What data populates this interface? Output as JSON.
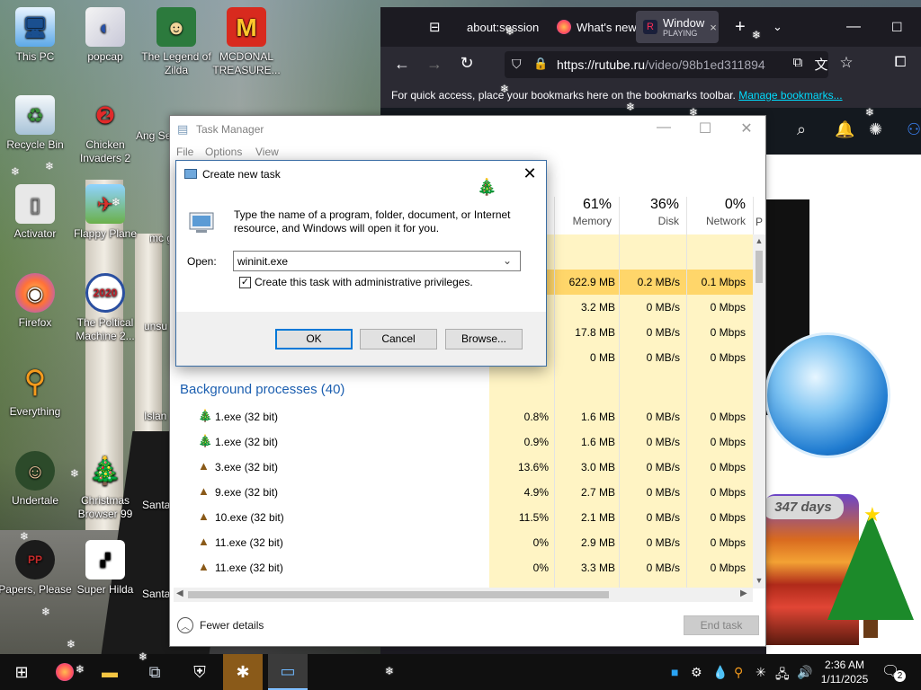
{
  "desktop": {
    "icons": [
      {
        "label": "This PC",
        "icon": "computer-icon"
      },
      {
        "label": "popcap",
        "icon": "popcap-icon"
      },
      {
        "label": "The Legend of Zilda",
        "icon": "legend-of-zilda-icon"
      },
      {
        "label": "MCDONAL TREASURE...",
        "icon": "mcdonalds-icon"
      },
      {
        "label": "Recycle Bin",
        "icon": "recycle-bin-icon"
      },
      {
        "label": "Chicken Invaders 2",
        "icon": "chicken-invaders-icon"
      },
      {
        "label": "Ang Se",
        "icon": "game-icon"
      },
      {
        "label": "Activator",
        "icon": "activator-icon"
      },
      {
        "label": "Flappy Plane",
        "icon": "flappy-plane-icon"
      },
      {
        "label": "mc ga",
        "icon": "game-icon"
      },
      {
        "label": "Firefox",
        "icon": "firefox-icon"
      },
      {
        "label": "The Poltical Machine 2...",
        "icon": "political-machine-icon"
      },
      {
        "label": "unsu",
        "icon": "game-icon"
      },
      {
        "label": "Everything",
        "icon": "everything-search-icon"
      },
      {
        "label": "Islan X",
        "icon": "game-icon"
      },
      {
        "label": "Undertale",
        "icon": "undertale-icon"
      },
      {
        "label": "Christmas Browser 99",
        "icon": "christmas-tree-icon"
      },
      {
        "label": "Santa Tro",
        "icon": "game-icon"
      },
      {
        "label": "Papers, Please",
        "icon": "papers-please-icon"
      },
      {
        "label": "Super Hilda",
        "icon": "super-hilda-icon"
      },
      {
        "label": "Santa Troub",
        "icon": "game-icon"
      }
    ]
  },
  "browser": {
    "tabs": [
      {
        "label": "about:session",
        "icon": "firefox-view-icon"
      },
      {
        "label": "What's new",
        "icon": "firefox-icon"
      },
      {
        "label": "Window",
        "sub": "PLAYING",
        "icon": "rutube-icon",
        "close": "×"
      }
    ],
    "new_tab": "+",
    "url_host": "https://rutube.ru",
    "url_path": "/video/98b1ed311894",
    "bookmarks_text": "For quick access, place your bookmarks here on the bookmarks toolbar.",
    "bookmarks_link": "Manage bookmarks..."
  },
  "snowglobe": {
    "days": "347 days"
  },
  "taskmgr": {
    "title": "Task Manager",
    "menu": [
      "File",
      "Options",
      "View"
    ],
    "columns": [
      {
        "pct": "61%",
        "label": "Memory"
      },
      {
        "pct": "36%",
        "label": "Disk"
      },
      {
        "pct": "0%",
        "label": "Network"
      }
    ],
    "col_cut": "P",
    "top_rows": [
      {
        "cpu": "",
        "memory": "622.9 MB",
        "disk": "0.2 MB/s",
        "network": "0.1 Mbps"
      },
      {
        "cpu": "",
        "memory": "3.2 MB",
        "disk": "0 MB/s",
        "network": "0 Mbps"
      },
      {
        "cpu": "",
        "memory": "17.8 MB",
        "disk": "0 MB/s",
        "network": "0 Mbps"
      },
      {
        "cpu": "",
        "memory": "0 MB",
        "disk": "0 MB/s",
        "network": "0 Mbps"
      }
    ],
    "section_title": "Background processes (40)",
    "bg_rows": [
      {
        "name": "1.exe (32 bit)",
        "icon": "tree-icon",
        "cpu": "0.8%",
        "memory": "1.6 MB",
        "disk": "0 MB/s",
        "network": "0 Mbps"
      },
      {
        "name": "1.exe (32 bit)",
        "icon": "tree-icon",
        "cpu": "0.9%",
        "memory": "1.6 MB",
        "disk": "0 MB/s",
        "network": "0 Mbps"
      },
      {
        "name": "3.exe (32 bit)",
        "icon": "poop-icon",
        "cpu": "13.6%",
        "memory": "3.0 MB",
        "disk": "0 MB/s",
        "network": "0 Mbps"
      },
      {
        "name": "9.exe (32 bit)",
        "icon": "poop-icon",
        "cpu": "4.9%",
        "memory": "2.7 MB",
        "disk": "0 MB/s",
        "network": "0 Mbps"
      },
      {
        "name": "10.exe (32 bit)",
        "icon": "poop-icon",
        "cpu": "11.5%",
        "memory": "2.1 MB",
        "disk": "0 MB/s",
        "network": "0 Mbps"
      },
      {
        "name": "11.exe (32 bit)",
        "icon": "poop-icon",
        "cpu": "0%",
        "memory": "2.9 MB",
        "disk": "0 MB/s",
        "network": "0 Mbps"
      },
      {
        "name": "11.exe (32 bit)",
        "icon": "poop-icon",
        "cpu": "0%",
        "memory": "3.3 MB",
        "disk": "0 MB/s",
        "network": "0 Mbps"
      }
    ],
    "fewer_details": "Fewer details",
    "end_task": "End task"
  },
  "dialog": {
    "title": "Create new task",
    "message": "Type the name of a program, folder, document, or Internet resource, and Windows will open it for you.",
    "open_label": "Open:",
    "open_value": "wininit.exe",
    "admin_label": "Create this task with administrative privileges.",
    "admin_checked": "✓",
    "ok": "OK",
    "cancel": "Cancel",
    "browse": "Browse..."
  },
  "taskbar": {
    "time": "2:36 AM",
    "date": "1/11/2025",
    "notifications": "2",
    "items": [
      "start-icon",
      "firefox-icon",
      "file-explorer-icon",
      "task-view-icon",
      "defender-icon",
      "network-app-icon",
      "run-dialog-icon"
    ]
  }
}
